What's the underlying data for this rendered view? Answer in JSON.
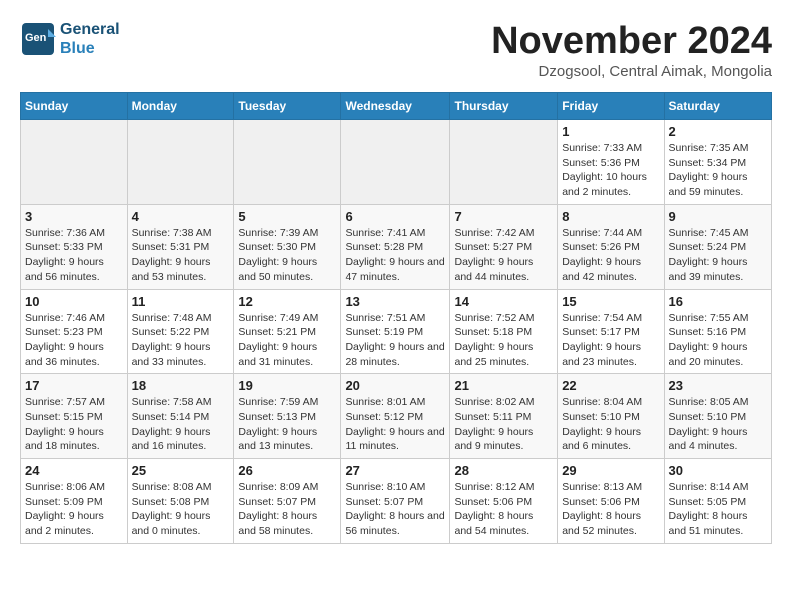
{
  "logo": {
    "line1": "General",
    "line2": "Blue"
  },
  "title": "November 2024",
  "location": "Dzogsool, Central Aimak, Mongolia",
  "weekdays": [
    "Sunday",
    "Monday",
    "Tuesday",
    "Wednesday",
    "Thursday",
    "Friday",
    "Saturday"
  ],
  "weeks": [
    [
      {
        "day": "",
        "info": ""
      },
      {
        "day": "",
        "info": ""
      },
      {
        "day": "",
        "info": ""
      },
      {
        "day": "",
        "info": ""
      },
      {
        "day": "",
        "info": ""
      },
      {
        "day": "1",
        "info": "Sunrise: 7:33 AM\nSunset: 5:36 PM\nDaylight: 10 hours and 2 minutes."
      },
      {
        "day": "2",
        "info": "Sunrise: 7:35 AM\nSunset: 5:34 PM\nDaylight: 9 hours and 59 minutes."
      }
    ],
    [
      {
        "day": "3",
        "info": "Sunrise: 7:36 AM\nSunset: 5:33 PM\nDaylight: 9 hours and 56 minutes."
      },
      {
        "day": "4",
        "info": "Sunrise: 7:38 AM\nSunset: 5:31 PM\nDaylight: 9 hours and 53 minutes."
      },
      {
        "day": "5",
        "info": "Sunrise: 7:39 AM\nSunset: 5:30 PM\nDaylight: 9 hours and 50 minutes."
      },
      {
        "day": "6",
        "info": "Sunrise: 7:41 AM\nSunset: 5:28 PM\nDaylight: 9 hours and 47 minutes."
      },
      {
        "day": "7",
        "info": "Sunrise: 7:42 AM\nSunset: 5:27 PM\nDaylight: 9 hours and 44 minutes."
      },
      {
        "day": "8",
        "info": "Sunrise: 7:44 AM\nSunset: 5:26 PM\nDaylight: 9 hours and 42 minutes."
      },
      {
        "day": "9",
        "info": "Sunrise: 7:45 AM\nSunset: 5:24 PM\nDaylight: 9 hours and 39 minutes."
      }
    ],
    [
      {
        "day": "10",
        "info": "Sunrise: 7:46 AM\nSunset: 5:23 PM\nDaylight: 9 hours and 36 minutes."
      },
      {
        "day": "11",
        "info": "Sunrise: 7:48 AM\nSunset: 5:22 PM\nDaylight: 9 hours and 33 minutes."
      },
      {
        "day": "12",
        "info": "Sunrise: 7:49 AM\nSunset: 5:21 PM\nDaylight: 9 hours and 31 minutes."
      },
      {
        "day": "13",
        "info": "Sunrise: 7:51 AM\nSunset: 5:19 PM\nDaylight: 9 hours and 28 minutes."
      },
      {
        "day": "14",
        "info": "Sunrise: 7:52 AM\nSunset: 5:18 PM\nDaylight: 9 hours and 25 minutes."
      },
      {
        "day": "15",
        "info": "Sunrise: 7:54 AM\nSunset: 5:17 PM\nDaylight: 9 hours and 23 minutes."
      },
      {
        "day": "16",
        "info": "Sunrise: 7:55 AM\nSunset: 5:16 PM\nDaylight: 9 hours and 20 minutes."
      }
    ],
    [
      {
        "day": "17",
        "info": "Sunrise: 7:57 AM\nSunset: 5:15 PM\nDaylight: 9 hours and 18 minutes."
      },
      {
        "day": "18",
        "info": "Sunrise: 7:58 AM\nSunset: 5:14 PM\nDaylight: 9 hours and 16 minutes."
      },
      {
        "day": "19",
        "info": "Sunrise: 7:59 AM\nSunset: 5:13 PM\nDaylight: 9 hours and 13 minutes."
      },
      {
        "day": "20",
        "info": "Sunrise: 8:01 AM\nSunset: 5:12 PM\nDaylight: 9 hours and 11 minutes."
      },
      {
        "day": "21",
        "info": "Sunrise: 8:02 AM\nSunset: 5:11 PM\nDaylight: 9 hours and 9 minutes."
      },
      {
        "day": "22",
        "info": "Sunrise: 8:04 AM\nSunset: 5:10 PM\nDaylight: 9 hours and 6 minutes."
      },
      {
        "day": "23",
        "info": "Sunrise: 8:05 AM\nSunset: 5:10 PM\nDaylight: 9 hours and 4 minutes."
      }
    ],
    [
      {
        "day": "24",
        "info": "Sunrise: 8:06 AM\nSunset: 5:09 PM\nDaylight: 9 hours and 2 minutes."
      },
      {
        "day": "25",
        "info": "Sunrise: 8:08 AM\nSunset: 5:08 PM\nDaylight: 9 hours and 0 minutes."
      },
      {
        "day": "26",
        "info": "Sunrise: 8:09 AM\nSunset: 5:07 PM\nDaylight: 8 hours and 58 minutes."
      },
      {
        "day": "27",
        "info": "Sunrise: 8:10 AM\nSunset: 5:07 PM\nDaylight: 8 hours and 56 minutes."
      },
      {
        "day": "28",
        "info": "Sunrise: 8:12 AM\nSunset: 5:06 PM\nDaylight: 8 hours and 54 minutes."
      },
      {
        "day": "29",
        "info": "Sunrise: 8:13 AM\nSunset: 5:06 PM\nDaylight: 8 hours and 52 minutes."
      },
      {
        "day": "30",
        "info": "Sunrise: 8:14 AM\nSunset: 5:05 PM\nDaylight: 8 hours and 51 minutes."
      }
    ]
  ]
}
